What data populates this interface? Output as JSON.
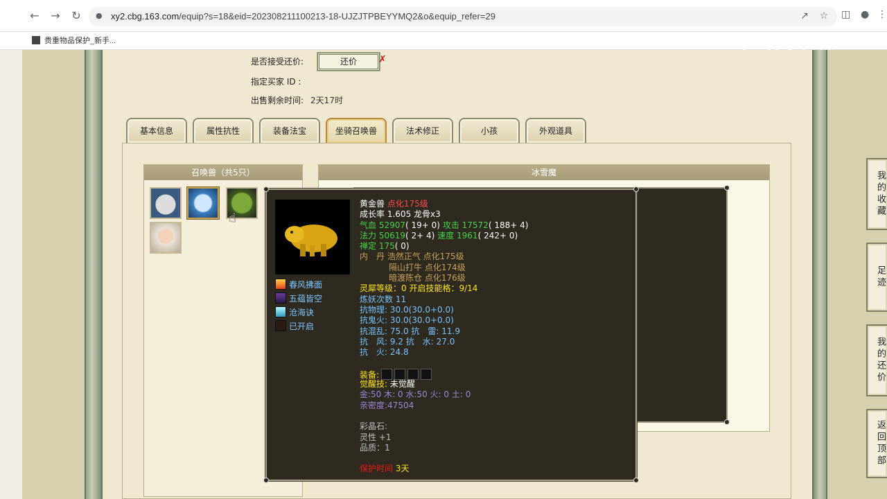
{
  "browser": {
    "url_host": "xy2.cbg.163.com",
    "url_path": "/equip?s=18&eid=202308211100213-18-UJZJTPBEYYMQ2&o&equip_refer=29",
    "bookmark": "贵重物品保护_新手..."
  },
  "watermark": "CC直播",
  "sale": {
    "accept_counter_label": "是否接受还价:",
    "counter_button": "还价",
    "buyer_id_label": "指定买家 ID :",
    "time_left_label": "出售剩余时间:",
    "time_left_value": "2天17时"
  },
  "tabs": [
    "基本信息",
    "属性抗性",
    "装备法宝",
    "坐骑召唤兽",
    "法术修正",
    "小孩",
    "外观道具"
  ],
  "pets_box": {
    "title": "召唤兽（共5只）"
  },
  "detail_box": {
    "title": "冰雪魔"
  },
  "popup": {
    "name": "黄金兽",
    "level": "点化175级",
    "growth_label": "成长率",
    "growth_value": "1.605",
    "growth_extra": "龙骨x3",
    "hp_label": "气血",
    "hp_value": "52907",
    "hp_extra": "( 19+ 0)",
    "atk_label": "攻击",
    "atk_value": "17572",
    "atk_extra": "( 188+ 4)",
    "mp_label": "法力",
    "mp_value": "50619",
    "mp_extra": "( 2+ 4)",
    "spd_label": "速度",
    "spd_value": "1961",
    "spd_extra": "( 242+ 0)",
    "focus_label": "禅定",
    "focus_value": "175",
    "focus_extra": "( 0)",
    "neidan_label": "内　丹",
    "neidan": [
      "浩然正气 点化175级",
      "隔山打牛 点化174级",
      "暗渡陈仓 点化176级"
    ],
    "lingxi": "灵犀等级：0 开启技能格：9/14",
    "lianyao": "炼妖次数 11",
    "resist": [
      "抗物理: 30.0(30.0+0.0)",
      "抗鬼火: 30.0(30.0+0.0)",
      "抗混乱: 75.0 抗　雷: 11.9",
      "抗　风: 9.2 抗　水: 27.0",
      "抗　火: 24.8"
    ],
    "equip_label": "装备:",
    "awaken_label": "觉醒技:",
    "awaken_value": "未觉醒",
    "elements": "金:50 木: 0 水:50 火: 0 土: 0",
    "intimacy": "亲密度:47504",
    "crystal_label": "彩晶石:",
    "spirit": "灵性 +1",
    "quality": "品质：1",
    "protect_label": "保护时间",
    "protect_value": "3天",
    "skills": [
      "春风拂面",
      "五蕴皆空",
      "沧海诀",
      "已开启"
    ]
  },
  "side_buttons": [
    "我的收藏",
    "足迹",
    "我的还价",
    "返回顶部"
  ]
}
